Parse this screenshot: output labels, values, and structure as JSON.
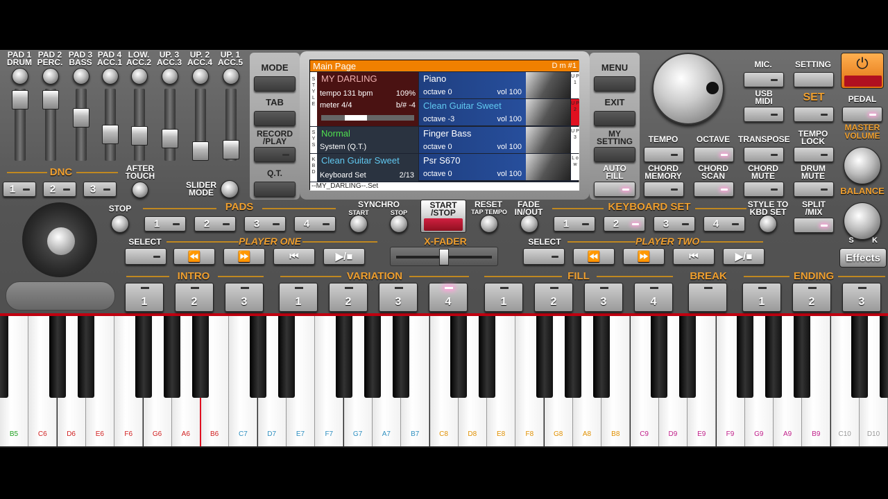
{
  "pads": [
    {
      "label": "PAD 1\nDRUM"
    },
    {
      "label": "PAD 2\nPERC."
    },
    {
      "label": "PAD 3\nBASS"
    },
    {
      "label": "PAD 4\nACC.1"
    },
    {
      "label": "LOW.\nACC.2"
    },
    {
      "label": "UP. 3\nACC.3"
    },
    {
      "label": "UP. 2\nACC.4"
    },
    {
      "label": "UP. 1\nACC.5"
    }
  ],
  "dnc": {
    "label": "DNC",
    "buttons": [
      "1",
      "2",
      "3"
    ],
    "after_touch": "AFTER\nTOUCH",
    "slider_mode": "SLIDER\nMODE"
  },
  "left_menu": {
    "mode": "MODE",
    "tab": "TAB",
    "record": "RECORD\n/PLAY",
    "qt": "Q.T."
  },
  "screen": {
    "title": "Main Page",
    "chord": "D m #1",
    "style_name": "MY DARLING",
    "tempo": "tempo 131 bpm",
    "tempo_pct": "109%",
    "meter": "meter 4/4",
    "transpose": "b/# -4",
    "sys_name": "Normal",
    "sys_sub": "System (Q.T.)",
    "kbd_name": "Clean Guitar Sweet",
    "kbd_sub": "Keyboard Set",
    "kbd_count": "2/13",
    "set_file": "--MY_DARLING--.Set",
    "side_style": "S T Y L E",
    "side_sys": "S Y S",
    "side_kbd": "K B D",
    "voices": [
      {
        "name": "Piano",
        "octave": "octave  0",
        "vol": "vol 100",
        "side": "U P 1"
      },
      {
        "name": "Clean Guitar Sweet",
        "octave": "octave -3",
        "vol": "vol 100",
        "side": "U P 2"
      },
      {
        "name": "Finger Bass",
        "octave": "octave  0",
        "vol": "vol 100",
        "side": "U P 3"
      },
      {
        "name": "Psr S670",
        "octave": "octave  0",
        "vol": "vol 100",
        "side": "L o w"
      }
    ]
  },
  "right_menu": {
    "menu": "MENU",
    "exit": "EXIT",
    "my_setting": "MY\nSETTING",
    "auto_fill": "AUTO\nFILL"
  },
  "top_right": {
    "mic": "MIC.",
    "setting": "SETTING",
    "usb_midi": "USB\nMIDI",
    "set": "SET",
    "pedal": "PEDAL",
    "master_volume": "MASTER\nVOLUME",
    "balance": "BALANCE",
    "bal_s": "S",
    "bal_k": "K",
    "power_icon": "⏻",
    "tempo": "TEMPO",
    "octave": "OCTAVE",
    "transpose": "TRANSPOSE",
    "tempo_lock": "TEMPO\nLOCK",
    "chord_memory": "CHORD\nMEMORY",
    "chord_scan": "CHORD\nSCAN",
    "chord_mute": "CHORD\nMUTE",
    "drum_mute": "DRUM\nMUTE"
  },
  "pads_row": {
    "stop": "STOP",
    "title": "PADS",
    "buttons": [
      "1",
      "2",
      "3",
      "4"
    ]
  },
  "transport": {
    "synchro": "SYNCHRO",
    "start": "START",
    "stop": "STOP",
    "start_stop": "START\n/STOP",
    "reset": "RESET",
    "tap_tempo": "TAP TEMPO",
    "fade": "FADE\nIN/OUT"
  },
  "keyboard_set": {
    "title": "KEYBOARD SET",
    "buttons": [
      "1",
      "2",
      "3",
      "4"
    ],
    "style_to": "STYLE TO\nKBD SET",
    "split_mix": "SPLIT\n/MIX"
  },
  "player_one": {
    "select": "SELECT",
    "title": "PLAYER ONE"
  },
  "player_two": {
    "select": "SELECT",
    "title": "PLAYER TWO"
  },
  "xfader": "X-FADER",
  "effects": "Effects",
  "intro": {
    "title": "INTRO",
    "buttons": [
      "1",
      "2",
      "3"
    ]
  },
  "variation": {
    "title": "VARIATION",
    "buttons": [
      "1",
      "2",
      "3",
      "4"
    ]
  },
  "fill": {
    "title": "FILL",
    "buttons": [
      "1",
      "2",
      "3",
      "4"
    ]
  },
  "break": {
    "title": "BREAK"
  },
  "ending": {
    "title": "ENDING",
    "buttons": [
      "1",
      "2",
      "3"
    ]
  },
  "keys": [
    {
      "note": "B5",
      "color": "#20a020"
    },
    {
      "note": "C6",
      "color": "#d02020"
    },
    {
      "note": "D6",
      "color": "#d02020"
    },
    {
      "note": "E6",
      "color": "#d02020"
    },
    {
      "note": "F6",
      "color": "#d02020"
    },
    {
      "note": "G6",
      "color": "#d02020"
    },
    {
      "note": "A6",
      "color": "#d02020"
    },
    {
      "note": "B6",
      "color": "#d02020"
    },
    {
      "note": "C7",
      "color": "#3090c0"
    },
    {
      "note": "D7",
      "color": "#3090c0"
    },
    {
      "note": "E7",
      "color": "#3090c0"
    },
    {
      "note": "F7",
      "color": "#3090c0"
    },
    {
      "note": "G7",
      "color": "#3090c0"
    },
    {
      "note": "A7",
      "color": "#3090c0"
    },
    {
      "note": "B7",
      "color": "#3090c0"
    },
    {
      "note": "C8",
      "color": "#e09000"
    },
    {
      "note": "D8",
      "color": "#e09000"
    },
    {
      "note": "E8",
      "color": "#e09000"
    },
    {
      "note": "F8",
      "color": "#e09000"
    },
    {
      "note": "G8",
      "color": "#e09000"
    },
    {
      "note": "A8",
      "color": "#e09000"
    },
    {
      "note": "B8",
      "color": "#e09000"
    },
    {
      "note": "C9",
      "color": "#c0208a"
    },
    {
      "note": "D9",
      "color": "#c0208a"
    },
    {
      "note": "E9",
      "color": "#c0208a"
    },
    {
      "note": "F9",
      "color": "#c0208a"
    },
    {
      "note": "G9",
      "color": "#c0208a"
    },
    {
      "note": "A9",
      "color": "#c0208a"
    },
    {
      "note": "B9",
      "color": "#c0208a"
    },
    {
      "note": "C10",
      "color": "#999999"
    },
    {
      "note": "D10",
      "color": "#999999"
    }
  ]
}
